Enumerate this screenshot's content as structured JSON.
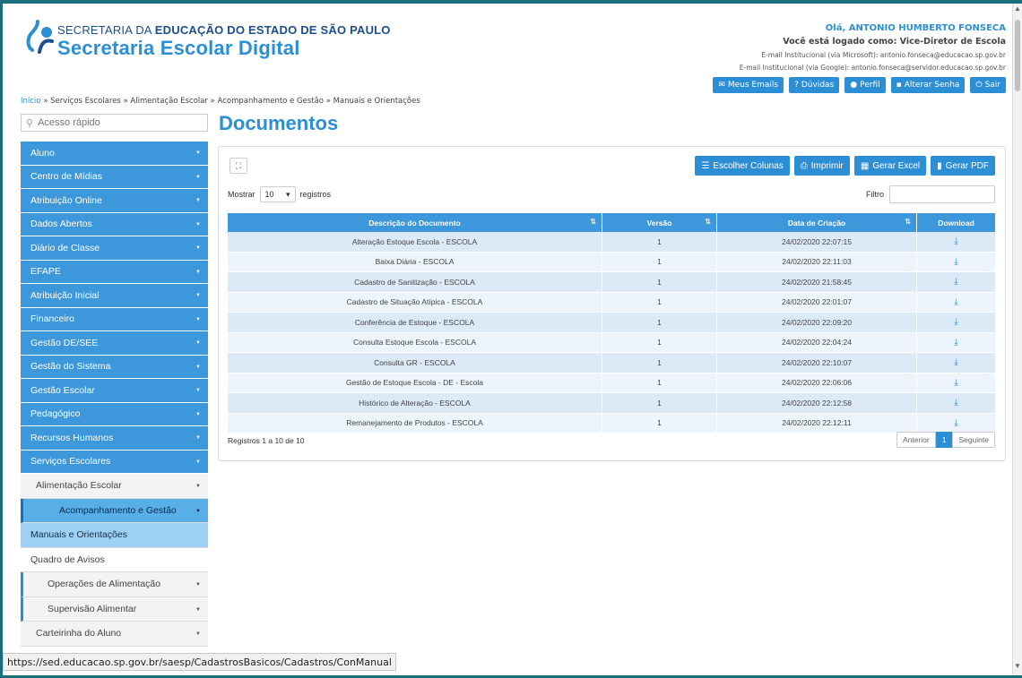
{
  "header": {
    "brand_top_prefix": "SECRETARIA DA ",
    "brand_top_bold": "EDUCAÇÃO DO ESTADO DE SÃO PAULO",
    "brand_main": "Secretaria Escolar Digital",
    "user_hello": "Olá, ANTONIO HUMBERTO FONSECA",
    "user_role": "Você está logado como: Vice-Diretor de Escola",
    "email_ms": "E-mail Institucional (via Microsoft): antonio.fonseca@educacao.sp.gov.br",
    "email_google": "E-mail Institucional (via Google): antonio.fonseca@servidor.educacao.sp.gov.br",
    "buttons": [
      "Meus Emails",
      "Dúvidas",
      "Perfil",
      "Alterar Senha",
      "Sair"
    ]
  },
  "breadcrumb": {
    "home": "Início",
    "trail": " » Serviços Escolares » Alimentação Escolar » Acompanhamento e Gestão » Manuais e Orientações"
  },
  "sidebar": {
    "search_placeholder": "Acesso rápido",
    "items": [
      "Aluno",
      "Centro de Mídias",
      "Atribuição Online",
      "Dados Abertos",
      "Diário de Classe",
      "EFAPE",
      "Atribuição Inicial",
      "Financeiro",
      "Gestão DE/SEE",
      "Gestão do Sistema",
      "Gestão Escolar",
      "Pedagógico",
      "Recursos Humanos",
      "Serviços Escolares"
    ],
    "sub_alimentacao": "Alimentação Escolar",
    "sub_acompanhamento": "Acompanhamento e Gestão",
    "sub_manuais": "Manuais e Orientações",
    "sub_quadro": "Quadro de Avisos",
    "sub_operacoes": "Operações de Alimentação",
    "sub_supervisao": "Supervisão Alimentar",
    "sub_carteirinha": "Carteirinha do Aluno"
  },
  "main": {
    "title": "Documentos",
    "toolbar": [
      "Escolher Colunas",
      "Imprimir",
      "Gerar Excel",
      "Gerar PDF"
    ],
    "show_prefix": "Mostrar",
    "show_value": "10",
    "show_suffix": "registros",
    "filter_label": "Filtro",
    "filter_value": "",
    "columns": [
      "Descrição do Documento",
      "Versão",
      "Data de Criação",
      "Download"
    ],
    "rows": [
      {
        "desc": "Alteração Estoque Escola - ESCOLA",
        "ver": "1",
        "date": "24/02/2020 22:07:15"
      },
      {
        "desc": "Baixa Diária - ESCOLA",
        "ver": "1",
        "date": "24/02/2020 22:11:03"
      },
      {
        "desc": "Cadastro de Sanitização - ESCOLA",
        "ver": "1",
        "date": "24/02/2020 21:58:45"
      },
      {
        "desc": "Cadastro de Situação Atípica - ESCOLA",
        "ver": "1",
        "date": "24/02/2020 22:01:07"
      },
      {
        "desc": "Conferência de Estoque - ESCOLA",
        "ver": "1",
        "date": "24/02/2020 22:09:20"
      },
      {
        "desc": "Consulta Estoque Escola - ESCOLA",
        "ver": "1",
        "date": "24/02/2020 22:04:24"
      },
      {
        "desc": "Consulta GR - ESCOLA",
        "ver": "1",
        "date": "24/02/2020 22:10:07"
      },
      {
        "desc": "Gestão de Estoque Escola - DE - Escola",
        "ver": "1",
        "date": "24/02/2020 22:06:06"
      },
      {
        "desc": "Histórico de Alteração - ESCOLA",
        "ver": "1",
        "date": "24/02/2020 22:12:58"
      },
      {
        "desc": "Remanejamento de Produtos - ESCOLA",
        "ver": "1",
        "date": "24/02/2020 22:12:11"
      }
    ],
    "records_info": "Registros 1 a 10 de 10",
    "pager": [
      "Anterior",
      "1",
      "Seguinte"
    ]
  },
  "status_url": "https://sed.educacao.sp.gov.br/saesp/CadastrosBasicos/Cadastros/ConManual",
  "colors": {
    "accent": "#2c8fd6",
    "sidebar": "#3d97db",
    "frame": "#1b6f7a"
  }
}
